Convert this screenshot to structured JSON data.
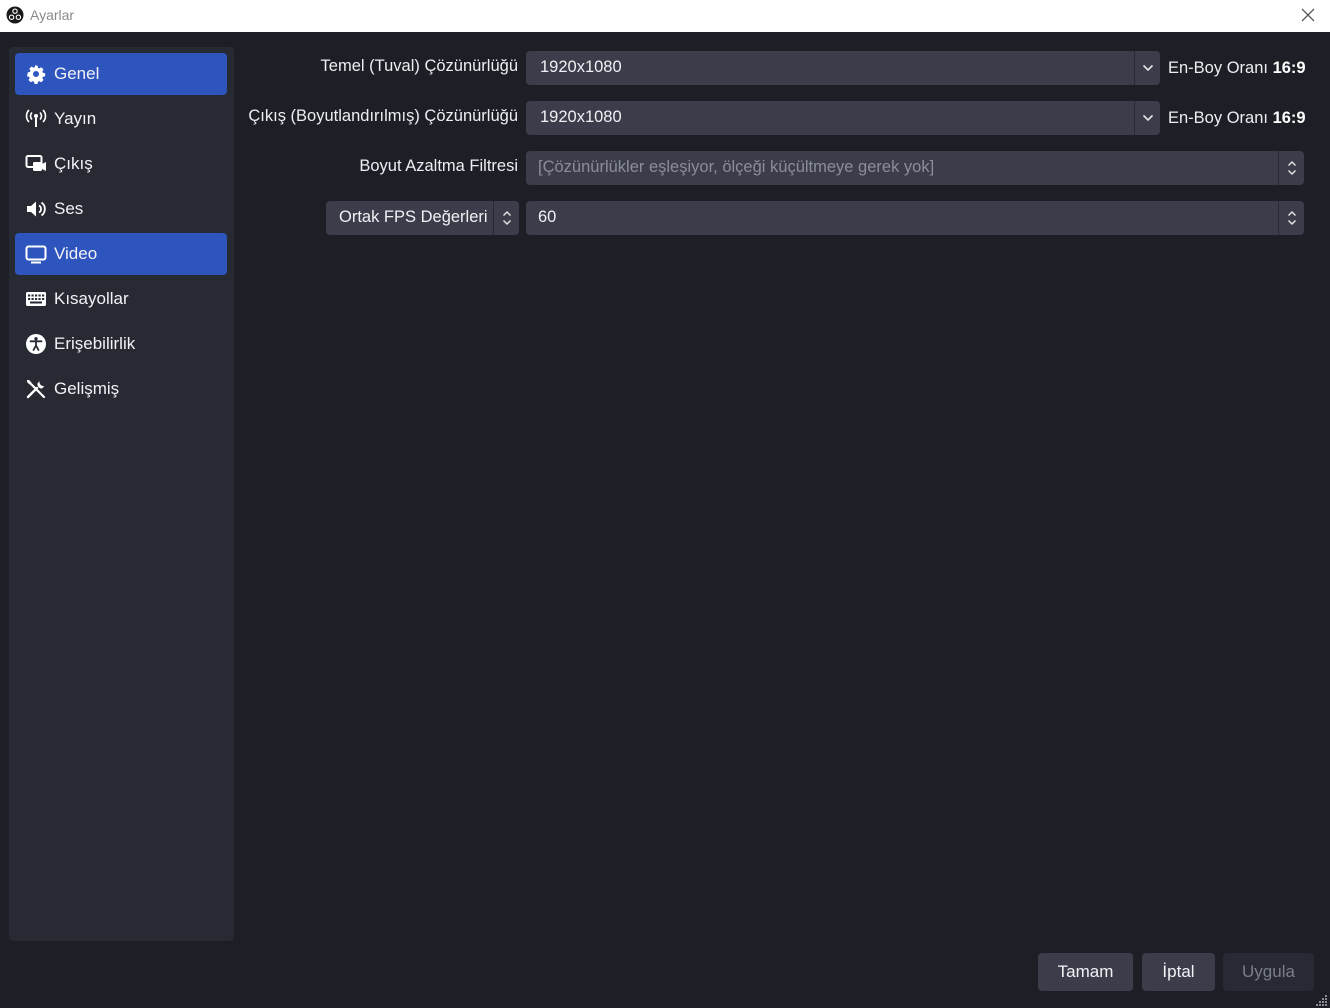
{
  "window": {
    "title": "Ayarlar"
  },
  "sidebar": {
    "items": [
      {
        "label": "Genel",
        "icon": "gear-icon",
        "active": true
      },
      {
        "label": "Yayın",
        "icon": "antenna-icon",
        "active": false
      },
      {
        "label": "Çıkış",
        "icon": "output-icon",
        "active": false
      },
      {
        "label": "Ses",
        "icon": "speaker-icon",
        "active": false
      },
      {
        "label": "Video",
        "icon": "monitor-icon",
        "active": true
      },
      {
        "label": "Kısayollar",
        "icon": "keyboard-icon",
        "active": false
      },
      {
        "label": "Erişebilirlik",
        "icon": "accessibility-icon",
        "active": false
      },
      {
        "label": "Gelişmiş",
        "icon": "tools-icon",
        "active": false
      }
    ]
  },
  "video": {
    "base_resolution": {
      "label": "Temel (Tuval) Çözünürlüğü",
      "value": "1920x1080",
      "aspect_label": "En-Boy Oranı",
      "aspect_value": "16:9"
    },
    "output_resolution": {
      "label": "Çıkış (Boyutlandırılmış) Çözünürlüğü",
      "value": "1920x1080",
      "aspect_label": "En-Boy Oranı",
      "aspect_value": "16:9"
    },
    "downscale_filter": {
      "label": "Boyut Azaltma Filtresi",
      "placeholder": "[Çözünürlükler eşleşiyor, ölçeği küçültmeye gerek yok]"
    },
    "fps": {
      "type_value": "Ortak FPS Değerleri",
      "value": "60"
    }
  },
  "buttons": {
    "ok": "Tamam",
    "cancel": "İptal",
    "apply": "Uygula"
  },
  "colors": {
    "background": "#1d1f26",
    "sidebar": "#272a33",
    "accent": "#2d55bd",
    "field": "#3b3e4a"
  }
}
